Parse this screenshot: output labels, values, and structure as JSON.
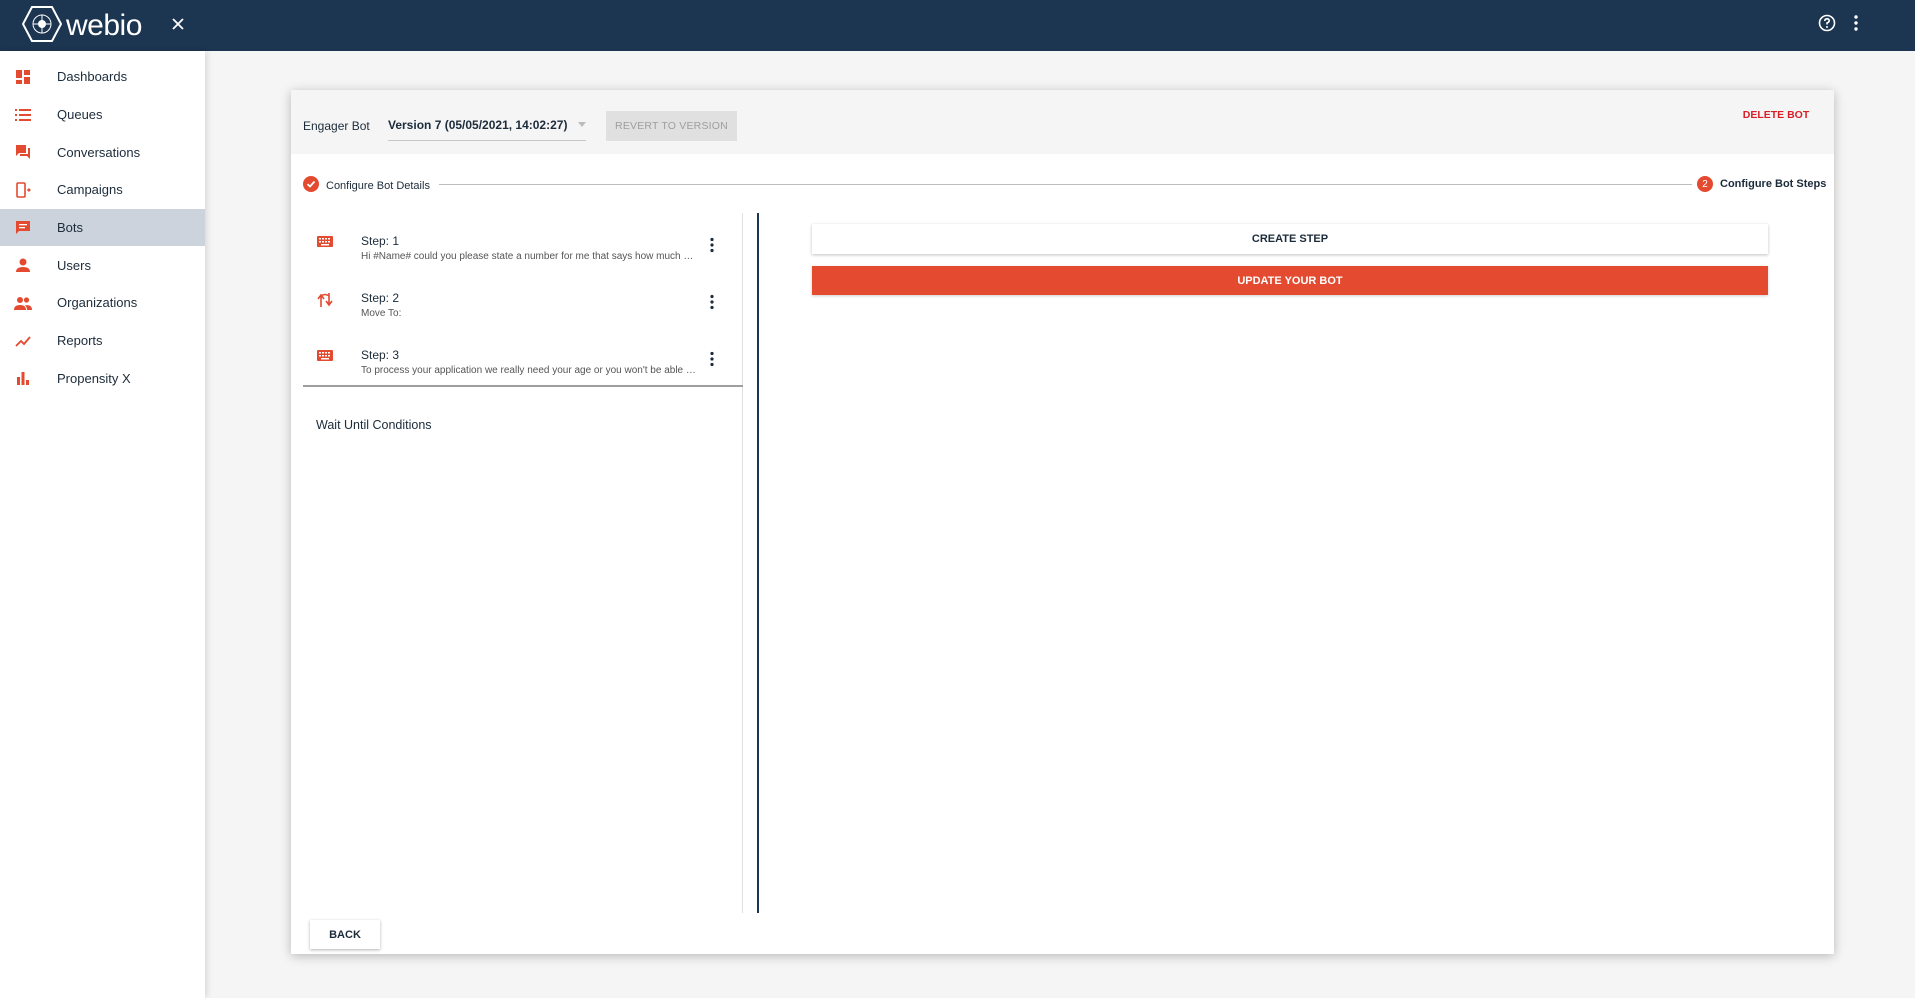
{
  "app": {
    "logo_text": "webio",
    "brand_color": "#1c3550",
    "accent_color": "#e34a30",
    "icons": [
      "webio-logo-icon",
      "close-icon",
      "help-icon",
      "more-vert-icon"
    ]
  },
  "sidebar": {
    "items": [
      {
        "label": "Dashboards",
        "icon": "dashboard-icon",
        "active": false
      },
      {
        "label": "Queues",
        "icon": "list-icon",
        "active": false
      },
      {
        "label": "Conversations",
        "icon": "forum-icon",
        "active": false
      },
      {
        "label": "Campaigns",
        "icon": "phone-forward-icon",
        "active": false
      },
      {
        "label": "Bots",
        "icon": "chat-icon",
        "active": true
      },
      {
        "label": "Users",
        "icon": "person-icon",
        "active": false
      },
      {
        "label": "Organizations",
        "icon": "people-icon",
        "active": false
      },
      {
        "label": "Reports",
        "icon": "trending-up-icon",
        "active": false
      },
      {
        "label": "Propensity X",
        "icon": "bar-chart-icon",
        "active": false
      }
    ]
  },
  "header": {
    "bot_name": "Engager Bot",
    "version": "Version 7 (05/05/2021, 14:02:27)",
    "revert_label": "REVERT TO VERSION",
    "delete_label": "DELETE BOT"
  },
  "stepper": {
    "step1_label": "Configure Bot Details",
    "step2_number": "2",
    "step2_label": "Configure Bot Steps"
  },
  "steps": [
    {
      "title": "Step: 1",
      "desc": "Hi #Name# could you please state a number for me that says how much you would like to borrow",
      "icon": "keyboard-icon"
    },
    {
      "title": "Step: 2",
      "desc": "Move To:",
      "icon": "swap-arrows-icon"
    },
    {
      "title": "Step: 3",
      "desc": "To process your application we really need your age or you won't be able to proceed",
      "icon": "keyboard-icon"
    }
  ],
  "wait_conditions_label": "Wait Until Conditions",
  "actions": {
    "create_step_label": "CREATE STEP",
    "update_bot_label": "UPDATE YOUR BOT",
    "back_label": "BACK"
  }
}
